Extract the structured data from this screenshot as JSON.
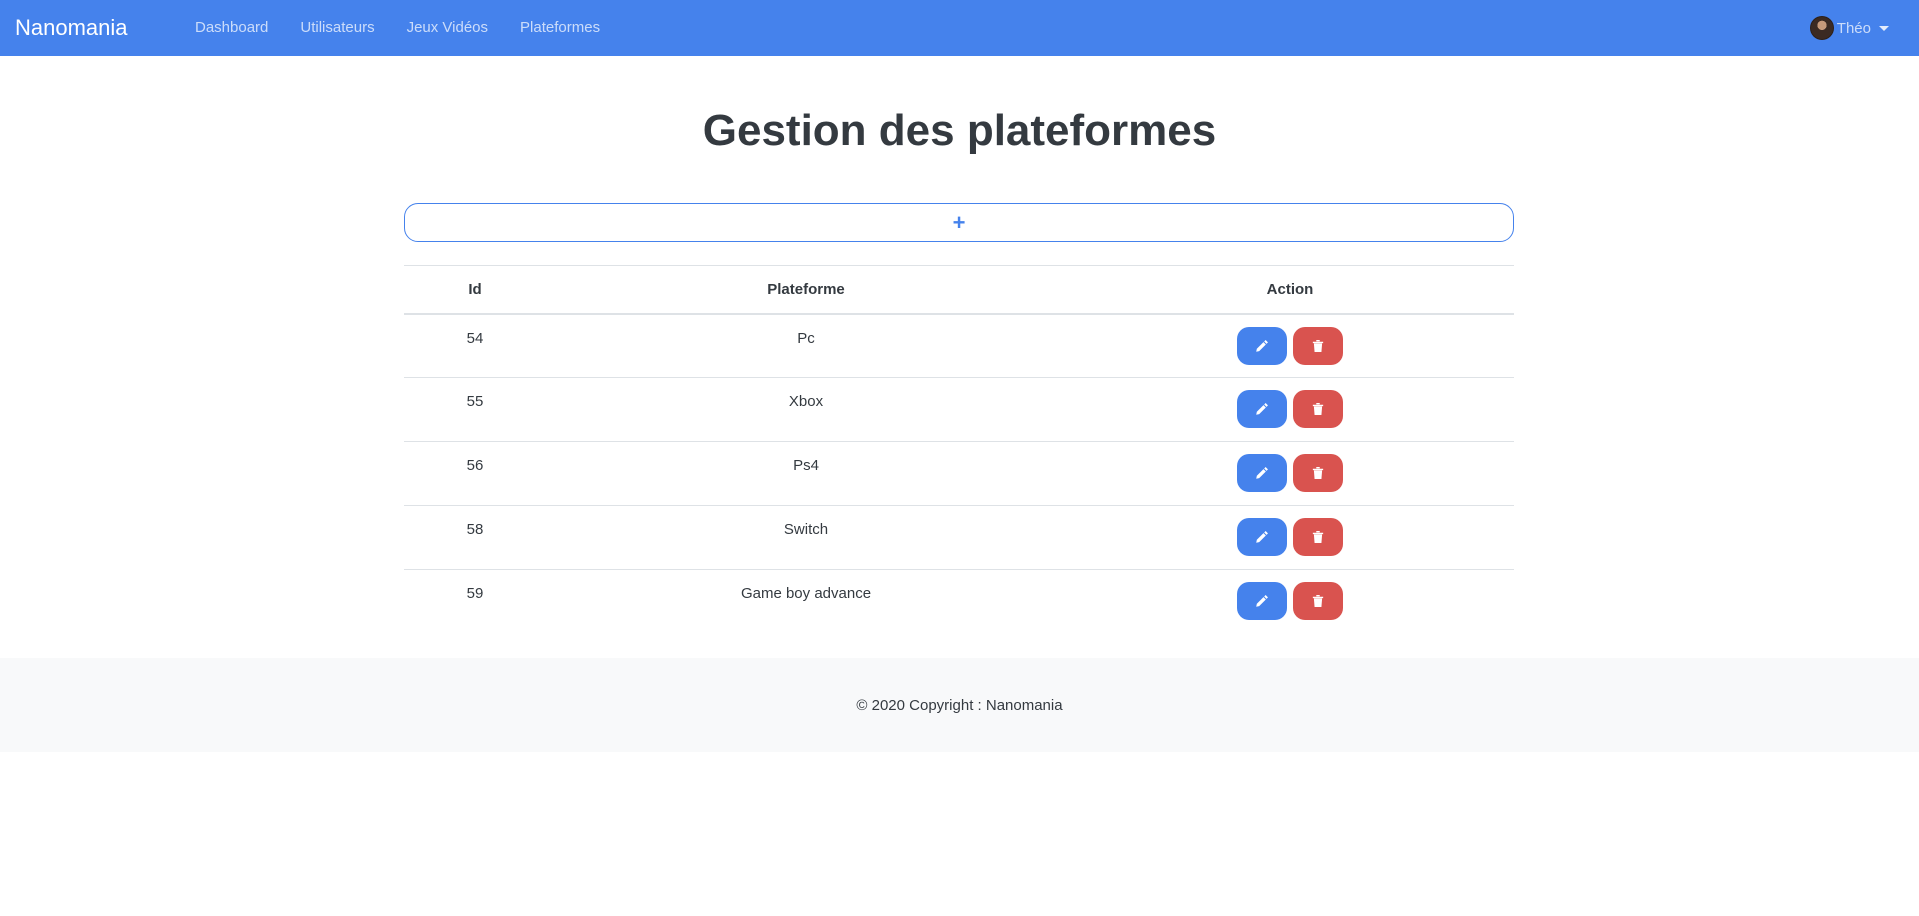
{
  "navbar": {
    "brand": "Nanomania",
    "links": [
      {
        "label": "Dashboard"
      },
      {
        "label": "Utilisateurs"
      },
      {
        "label": "Jeux Vidéos"
      },
      {
        "label": "Plateformes"
      }
    ],
    "user": {
      "name": "Théo",
      "avatar_icon": "user-avatar",
      "dropdown_icon": "caret-down-icon"
    }
  },
  "main": {
    "title": "Gestion des plateformes",
    "add_button_label": "+",
    "table": {
      "headers": {
        "id": "Id",
        "name": "Plateforme",
        "action": "Action"
      },
      "rows": [
        {
          "id": "54",
          "name": "Pc"
        },
        {
          "id": "55",
          "name": "Xbox"
        },
        {
          "id": "56",
          "name": "Ps4"
        },
        {
          "id": "58",
          "name": "Switch"
        },
        {
          "id": "59",
          "name": "Game boy advance"
        }
      ],
      "edit_icon": "pencil-icon",
      "delete_icon": "trash-icon"
    }
  },
  "footer": {
    "text": "© 2020 Copyright : Nanomania"
  },
  "colors": {
    "primary": "#4582ec",
    "danger": "#d9534f",
    "footer_bg": "#f8f9fa"
  }
}
